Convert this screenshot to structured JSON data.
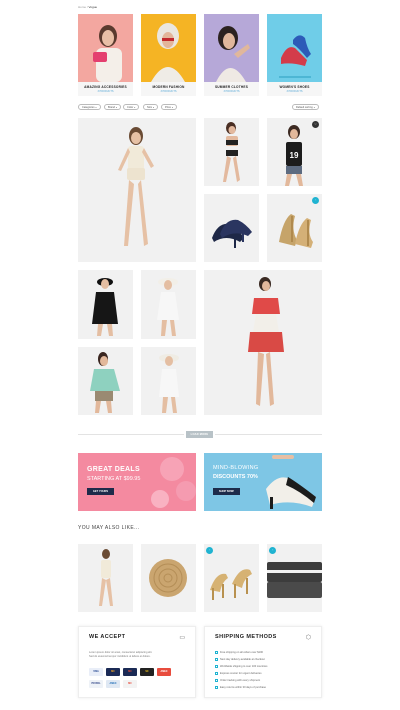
{
  "breadcrumb": {
    "home": "Home",
    "sep": "/",
    "current": "Vogue"
  },
  "categories": [
    {
      "title": "AMAZING ACCESSORIES",
      "count": "3 PRODUCTS"
    },
    {
      "title": "MODERN FASHION",
      "count": "3 PRODUCTS"
    },
    {
      "title": "SUMMER CLOTHES",
      "count": "3 PRODUCTS"
    },
    {
      "title": "WOMEN'S SHOES",
      "count": "3 PRODUCTS"
    }
  ],
  "filters": [
    "Categories",
    "Brand",
    "Color",
    "Size",
    "Price"
  ],
  "sort": "Default sorting",
  "load_more": "LOAD MORE",
  "banners": [
    {
      "line1": "GREAT DEALS",
      "line2": "STARTING AT $99.95",
      "button": "GET YOURS"
    },
    {
      "line1": "MIND-BLOWING",
      "line2": "DISCOUNTS 70%",
      "button": "SHOP NOW!"
    }
  ],
  "also_like": "YOU MAY ALSO LIKE...",
  "we_accept": {
    "title": "WE ACCEPT",
    "text": [
      "Lorem ipsum dolor sit amet, consectetur adipiscing elit.",
      "Sed do eiusmod tempor incididunt ut labore et dolore."
    ],
    "cards": [
      "VISA",
      "MC",
      "MC",
      "SC",
      "AMEX",
      "PAYPAL",
      "AMEX",
      "MC"
    ]
  },
  "shipping": {
    "title": "SHIPPING METHODS",
    "items": [
      "Free shipping on all orders over $100",
      "Next day delivery available at checkout",
      "Worldwide shipping to over 100 countries",
      "Express courier for urgent deliveries",
      "Order tracking with every shipment",
      "Easy returns within 30 days of purchase"
    ]
  },
  "colors": {
    "accent": "#1fb3d1",
    "pink": "#f48aa0",
    "blue": "#7ec6e5",
    "navy": "#1d2b4a"
  }
}
